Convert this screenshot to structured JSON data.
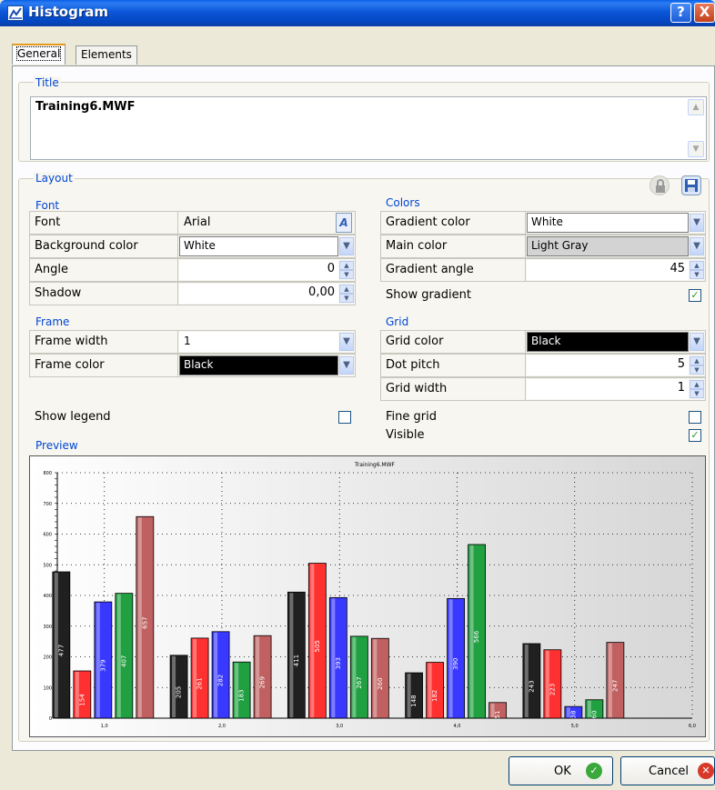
{
  "window": {
    "title": "Histogram",
    "help_label": "?",
    "close_label": "X"
  },
  "tabs": [
    {
      "label": "General",
      "active": true
    },
    {
      "label": "Elements",
      "active": false
    }
  ],
  "title_section": {
    "label": "Title",
    "value": "Training6.MWF"
  },
  "layout": {
    "label": "Layout",
    "font": {
      "label": "Font",
      "rows": [
        {
          "label": "Font",
          "value": "Arial"
        },
        {
          "label": "Background color",
          "value": "White"
        },
        {
          "label": "Angle",
          "value": "0"
        },
        {
          "label": "Shadow",
          "value": "0,00"
        }
      ]
    },
    "frame": {
      "label": "Frame",
      "rows": [
        {
          "label": "Frame width",
          "value": "1"
        },
        {
          "label": "Frame color",
          "value": "Black"
        }
      ]
    },
    "show_legend": {
      "label": "Show legend",
      "checked": false
    },
    "colors": {
      "label": "Colors",
      "rows": [
        {
          "label": "Gradient color",
          "value": "White"
        },
        {
          "label": "Main color",
          "value": "Light Gray"
        },
        {
          "label": "Gradient angle",
          "value": "45"
        }
      ],
      "show_gradient": {
        "label": "Show gradient",
        "checked": true
      }
    },
    "grid": {
      "label": "Grid",
      "rows": [
        {
          "label": "Grid color",
          "value": "Black"
        },
        {
          "label": "Dot pitch",
          "value": "5"
        },
        {
          "label": "Grid width",
          "value": "1"
        }
      ],
      "fine_grid": {
        "label": "Fine grid",
        "checked": false
      },
      "visible": {
        "label": "Visible",
        "checked": true
      }
    },
    "preview_label": "Preview"
  },
  "chart_data": {
    "type": "bar",
    "title": "Training6.MWF",
    "ylim": [
      0,
      800
    ],
    "xlim": [
      0.6,
      6.0
    ],
    "yticks": [
      0,
      100,
      200,
      300,
      400,
      500,
      600,
      700,
      800
    ],
    "xticks": [
      "1,0",
      "2,0",
      "3,0",
      "4,0",
      "5,0",
      "6,0"
    ],
    "grid": true,
    "series_colors": [
      "#202020",
      "#ff3030",
      "#3838ff",
      "#20a040",
      "#c06060"
    ],
    "groups": [
      [
        477,
        154,
        379,
        407,
        657
      ],
      [
        205,
        261,
        282,
        183,
        269
      ],
      [
        411,
        505,
        393,
        267,
        260
      ],
      [
        148,
        182,
        390,
        566,
        51
      ],
      [
        243,
        223,
        38,
        60,
        247
      ]
    ]
  },
  "buttons": {
    "ok": "OK",
    "cancel": "Cancel"
  }
}
